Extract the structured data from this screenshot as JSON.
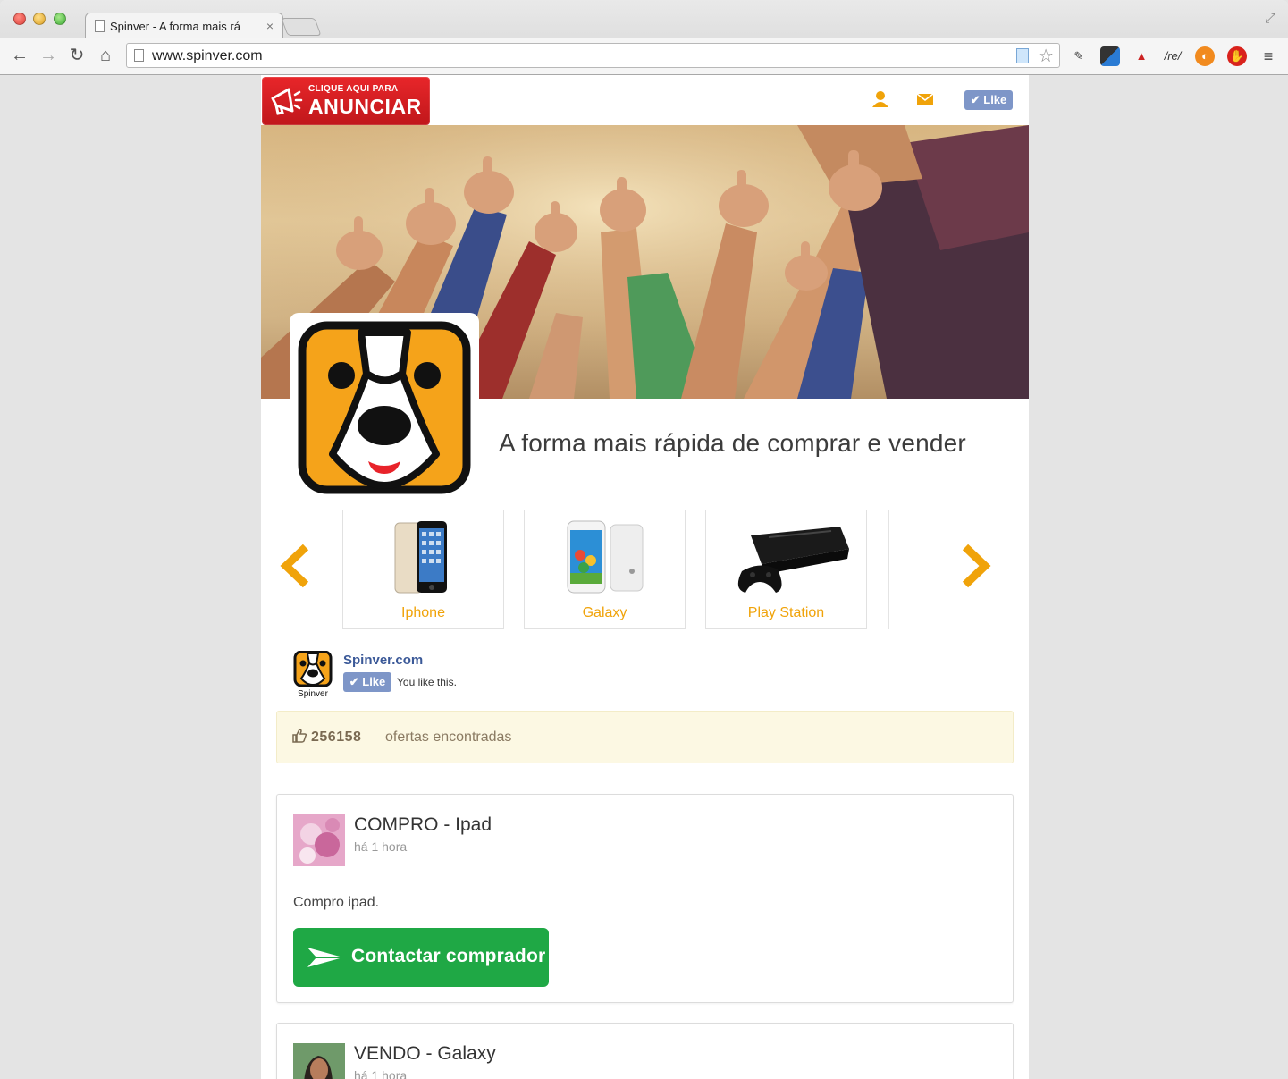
{
  "browser": {
    "tab_title": "Spinver - A forma mais rá",
    "tab_close": "×",
    "url": "www.spinver.com",
    "extension_re_label": "/re/"
  },
  "header": {
    "anunciar_small": "CLIQUE AQUI PARA",
    "anunciar_big": "ANUNCIAR",
    "like_label": "Like"
  },
  "tagline": "A forma mais rápida de comprar e vender",
  "carousel": {
    "items": [
      {
        "label": "Iphone"
      },
      {
        "label": "Galaxy"
      },
      {
        "label": "Play Station"
      }
    ]
  },
  "facebook": {
    "page_name": "Spinver.com",
    "logo_caption": "Spinver",
    "like_label": "Like",
    "status": "You like this."
  },
  "offers": {
    "count": "256158",
    "label": "ofertas encontradas"
  },
  "posts": [
    {
      "title": "COMPRO - Ipad",
      "time": "há 1 hora",
      "body": "Compro ipad.",
      "button": "Contactar comprador"
    },
    {
      "title": "VENDO - Galaxy",
      "time": "há 1 hora"
    }
  ],
  "colors": {
    "accent_orange": "#f0a30a",
    "contact_green": "#1fa845",
    "anunciar_red": "#d71f23",
    "facebook_blue": "#3b5998",
    "like_button": "#7e96c8"
  }
}
